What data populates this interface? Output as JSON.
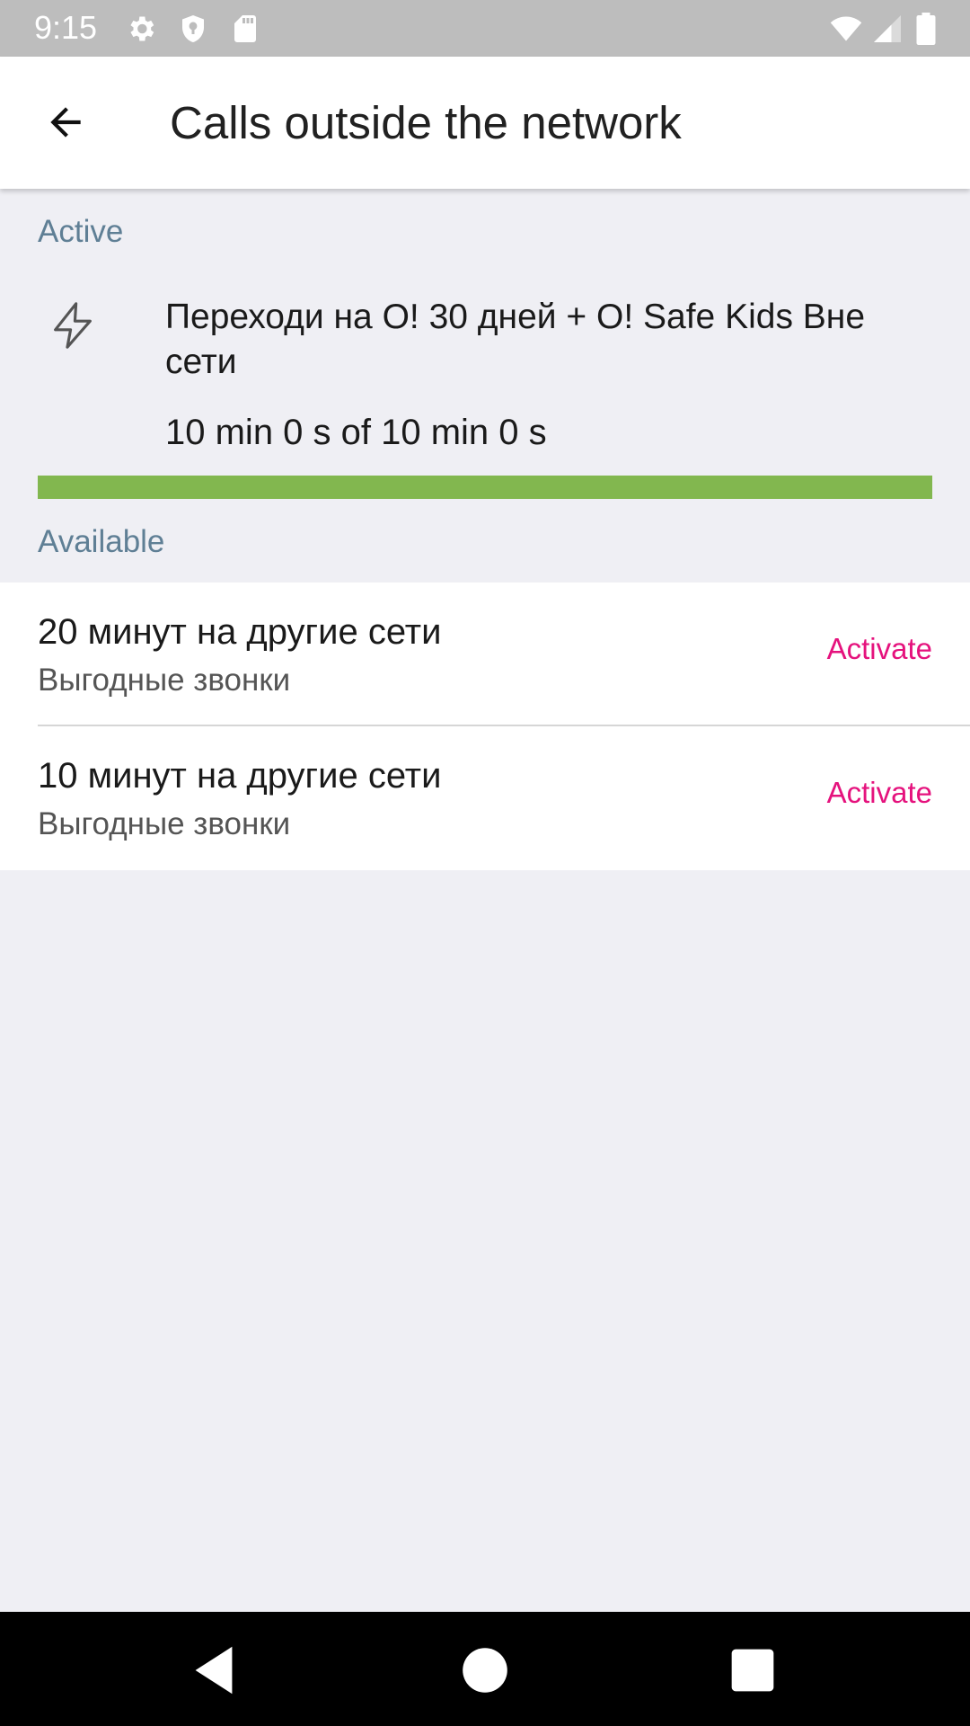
{
  "status_bar": {
    "time": "9:15",
    "left_icons": [
      "gear-icon",
      "shield-icon",
      "sd-card-icon"
    ],
    "right_icons": [
      "wifi-icon",
      "signal-icon",
      "battery-icon"
    ]
  },
  "app_bar": {
    "title": "Calls outside the network",
    "back_icon": "arrow-back-icon"
  },
  "active_section": {
    "header": "Active",
    "item": {
      "icon": "lightning-bolt-icon",
      "title": "Переходи на О! 30 дней + O! Safe Kids Вне сети",
      "usage": "10 min 0 s of 10 min 0 s",
      "progress_fraction": 1.0,
      "progress_color": "#82b74f"
    }
  },
  "available_section": {
    "header": "Available",
    "items": [
      {
        "title": "20 минут на другие сети",
        "subtitle": "Выгодные звонки",
        "action": "Activate"
      },
      {
        "title": "10 минут на другие сети",
        "subtitle": "Выгодные звонки",
        "action": "Activate"
      }
    ]
  },
  "colors": {
    "accent": "#e5127d",
    "section_header": "#5f7f95",
    "background": "#efeff4"
  },
  "nav_bar": {
    "icons": [
      "nav-back-icon",
      "nav-home-icon",
      "nav-recents-icon"
    ]
  }
}
